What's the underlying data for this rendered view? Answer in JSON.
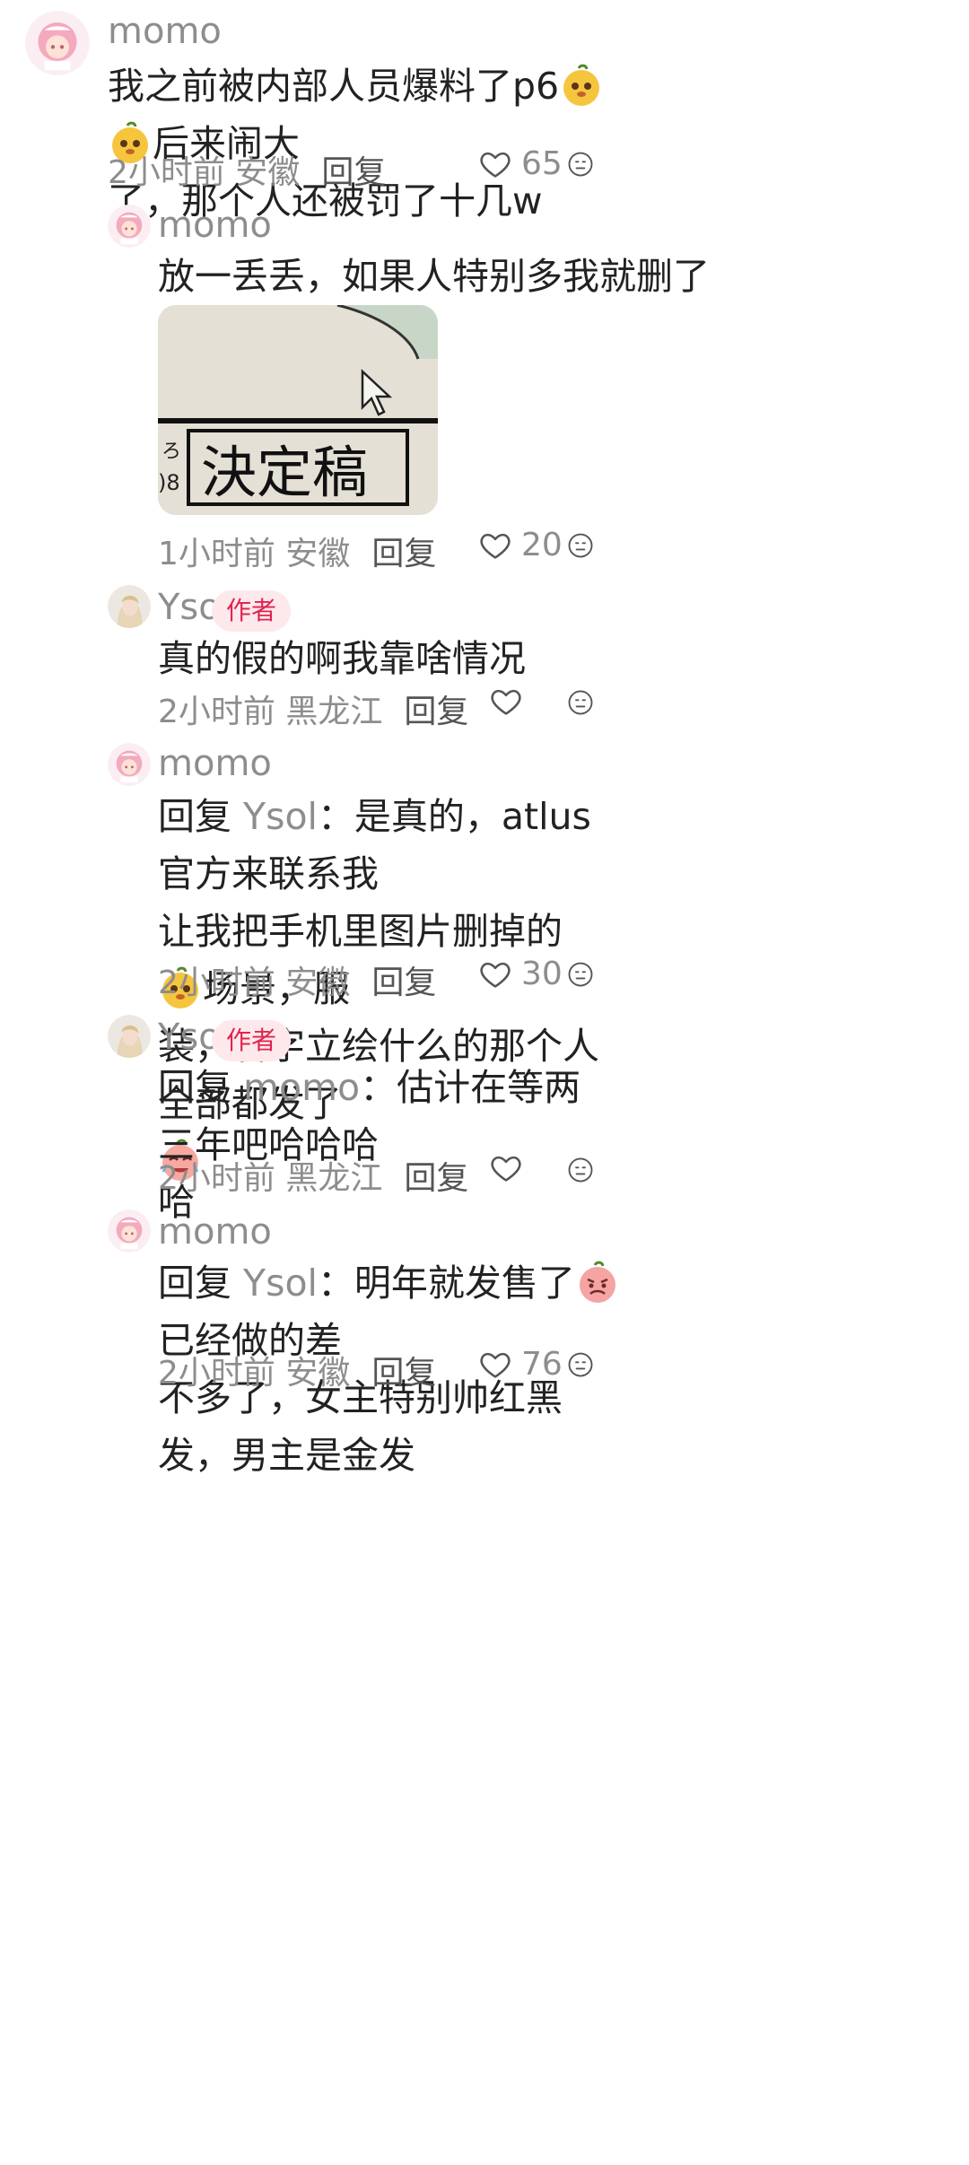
{
  "comments": [
    {
      "name": "momo",
      "text_before": "我之前被内部人员爆料了p6",
      "text_mid": "后来闹大",
      "text_line2": "了，那个人还被罚了十几w",
      "meta": "2小时前 安徽",
      "reply": "回复",
      "likes": "65"
    },
    {
      "name": "momo",
      "text": "放一丢丢，如果人特别多我就删了",
      "image_text": "決定稿",
      "meta": "1小时前 安徽",
      "reply": "回复",
      "likes": "20"
    },
    {
      "name": "Ysol",
      "badge": "作者",
      "text": "真的假的啊我靠啥情况",
      "meta": "2小时前 黑龙江",
      "reply": "回复"
    },
    {
      "name": "momo",
      "reply_prefix": "回复",
      "reply_to": "Ysol",
      "line1_rest": "：是真的，atlus官方来联系我",
      "line2_a": "让我把手机里图片删掉的",
      "line2_b": "场景，服",
      "line3": "装，名字立绘什么的那个人全部都发了",
      "meta": "2小时前 安徽",
      "reply": "回复",
      "likes": "30"
    },
    {
      "name": "Ysol",
      "badge": "作者",
      "reply_prefix": "回复",
      "reply_to": "momo",
      "line1_rest": "：估计在等两三年吧哈哈哈",
      "line2": "哈",
      "meta": "2小时前 黑龙江",
      "reply": "回复"
    },
    {
      "name": "momo",
      "reply_prefix": "回复",
      "reply_to": "Ysol",
      "line1_a": "：明年就发售了",
      "line1_b": "已经做的差",
      "line2": "不多了，女主特别帅红黑发，男主是金发",
      "meta": "2小时前 安徽",
      "reply": "回复",
      "likes": "76"
    }
  ]
}
